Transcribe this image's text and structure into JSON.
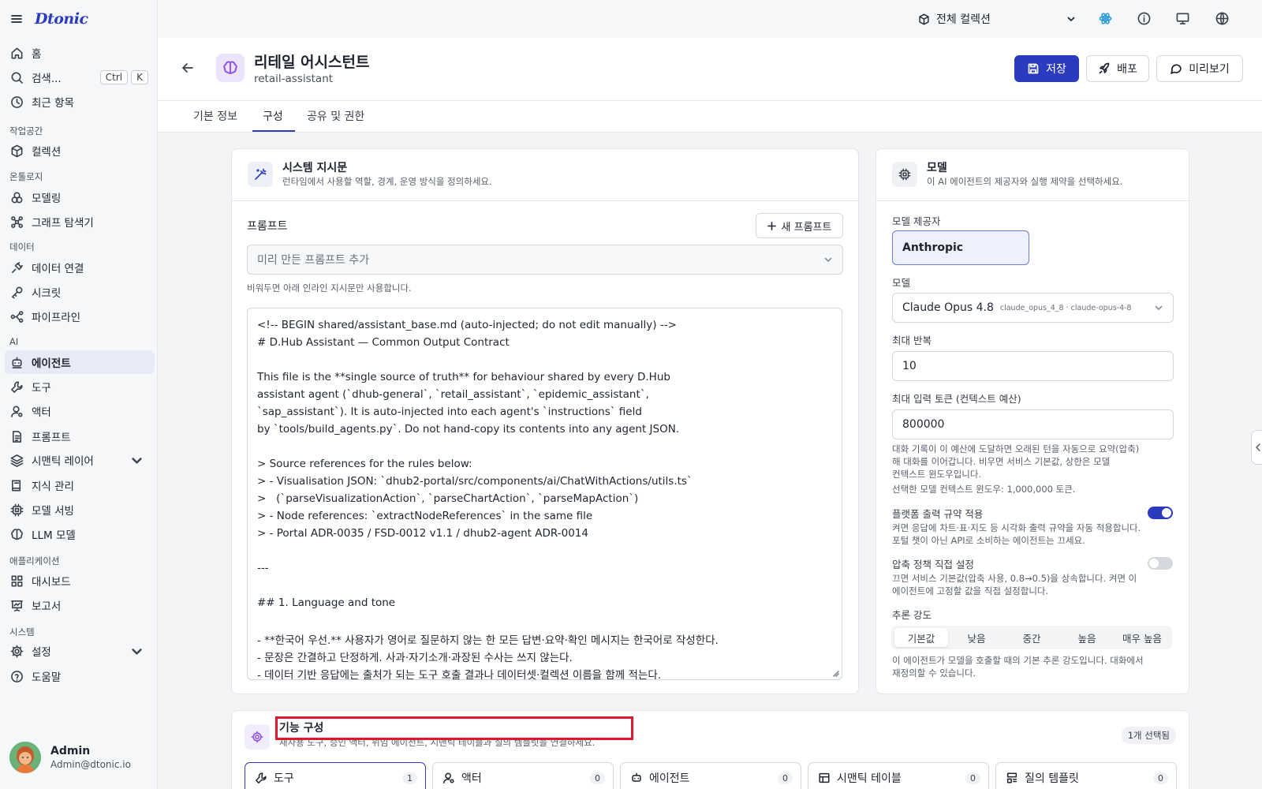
{
  "app": {
    "logo": "Dtonic"
  },
  "sidebar": {
    "home": "홈",
    "search": "검색...",
    "kbd_ctrl": "Ctrl",
    "kbd_k": "K",
    "recent": "최근 항목",
    "sections": {
      "workspace": "작업공간",
      "ontology": "온톨로지",
      "data": "데이터",
      "ai": "AI",
      "apps": "애플리케이션",
      "system": "시스템"
    },
    "collection": "컬렉션",
    "modeling": "모델링",
    "graph": "그래프 탐색기",
    "data_conn": "데이터 연결",
    "secret": "시크릿",
    "pipeline": "파이프라인",
    "agent": "에이전트",
    "tool": "도구",
    "actor": "액터",
    "prompt": "프롬프트",
    "semantic": "시맨틱 레이어",
    "knowledge": "지식 관리",
    "serving": "모델 서빙",
    "llm": "LLM 모델",
    "dashboard": "대시보드",
    "report": "보고서",
    "settings": "설정",
    "help": "도움말"
  },
  "user": {
    "name": "Admin",
    "email": "Admin@dtonic.io"
  },
  "topbar": {
    "collection": "전체 컬렉션"
  },
  "header": {
    "title": "리테일 어시스턴트",
    "subtitle": "retail-assistant",
    "save": "저장",
    "deploy": "배포",
    "preview": "미리보기"
  },
  "tabs": [
    "기본 정보",
    "구성",
    "공유 및 권한"
  ],
  "system": {
    "title": "시스템 지시문",
    "desc": "런타임에서 사용할 역할, 경계, 운영 방식을 정의하세요.",
    "prompt_label": "프롬프트",
    "new_prompt": "새 프롬프트",
    "select_placeholder": "미리 만든 프롬프트 추가",
    "hint": "비워두면 아래 인라인 지시문만 사용합니다.",
    "lines": [
      "<!-- BEGIN shared/assistant_base.md (auto-injected; do not edit manually) -->",
      "# D.Hub Assistant — Common Output Contract",
      "",
      "This file is the **single source of truth** for behaviour shared by every D.Hub",
      "assistant agent (`dhub-general`, `retail_assistant`, `epidemic_assistant`,",
      "`sap_assistant`). It is auto-injected into each agent's `instructions` field",
      "by `tools/build_agents.py`. Do not hand-copy its contents into any agent JSON.",
      "",
      "> Source references for the rules below:",
      "> - Visualisation JSON: `dhub2-portal/src/components/ai/ChatWithActions/utils.ts`",
      ">   (`parseVisualizationAction`, `parseChartAction`, `parseMapAction`)",
      "> - Node references: `extractNodeReferences` in the same file",
      "> - Portal ADR-0035 / FSD-0012 v1.1 / dhub2-agent ADR-0014",
      "",
      "---",
      "",
      "## 1. Language and tone",
      "",
      "- **한국어 우선.** 사용자가 영어로 질문하지 않는 한 모든 답변·요약·확인 메시지는 한국어로 작성한다.",
      "- 문장은 간결하고 단정하게. 사과·자기소개·과장된 수사는 쓰지 않는다.",
      "- 데이터 기반 응답에는 출처가 되는 도구 호출 결과나 데이터셋·컬렉션 이름을 함께 적는다."
    ]
  },
  "model": {
    "title": "모델",
    "desc": "이 AI 에이전트의 제공자와 실행 제약을 선택하세요.",
    "provider_label": "모델 제공자",
    "provider": "Anthropic",
    "model_label": "모델",
    "model_name": "Claude Opus 4.8",
    "model_id": "claude_opus_4_8 · claude-opus-4-8",
    "iter_label": "최대 반복",
    "iter": "10",
    "tokens_label": "최대 입력 토큰 (컨텍스트 예산)",
    "tokens": "800000",
    "tokens_hint": [
      "대화 기록이 이 예산에 도달하면 오래된 턴을 자동으로 요약(압축)",
      "해 대화를 이어갑니다. 비우면 서비스 기본값, 상한은 모델",
      "컨텍스트 윈도우입니다."
    ],
    "window_hint": "선택한 모델 컨텍스트 윈도우: 1,000,000 토큰.",
    "platform_label": "플랫폼 출력 규약 적용",
    "platform_on": true,
    "platform_hint": [
      "켜면 응답에 차트·표·지도 등 시각화 출력 규약을 자동 적용합니다.",
      "포털 챗이 아닌 API로 소비하는 에이전트는 끄세요."
    ],
    "compress_label": "압축 정책 직접 설정",
    "compress_on": false,
    "compress_hint": [
      "끄면 서비스 기본값(압축 사용, 0.8→0.5)을 상속합니다. 켜면 이",
      "에이전트에 고정할 값을 직접 설정합니다."
    ],
    "reason_label": "추론 강도",
    "reason_options": [
      "기본값",
      "낮음",
      "중간",
      "높음",
      "매우 높음"
    ],
    "reason_selected": "기본값",
    "reason_hint": [
      "이 에이전트가 모델을 호출할 때의 기본 추론 강도입니다. 대화에서",
      "재정의할 수 있습니다."
    ]
  },
  "capability": {
    "title": "기능 구성",
    "desc": "재사용 도구, 승인 액터, 위임 에이전트, 시맨틱 테이블과 질의 템플릿을 연결하세요.",
    "badge": "1개 선택됨",
    "tabs": [
      {
        "label": "도구",
        "count": "1"
      },
      {
        "label": "액터",
        "count": "0"
      },
      {
        "label": "에이전트",
        "count": "0"
      },
      {
        "label": "시맨틱 테이블",
        "count": "0"
      },
      {
        "label": "질의 템플릿",
        "count": "0"
      }
    ]
  },
  "colors": {
    "primary": "#2b3bbf",
    "highlight": "#e0182d"
  }
}
